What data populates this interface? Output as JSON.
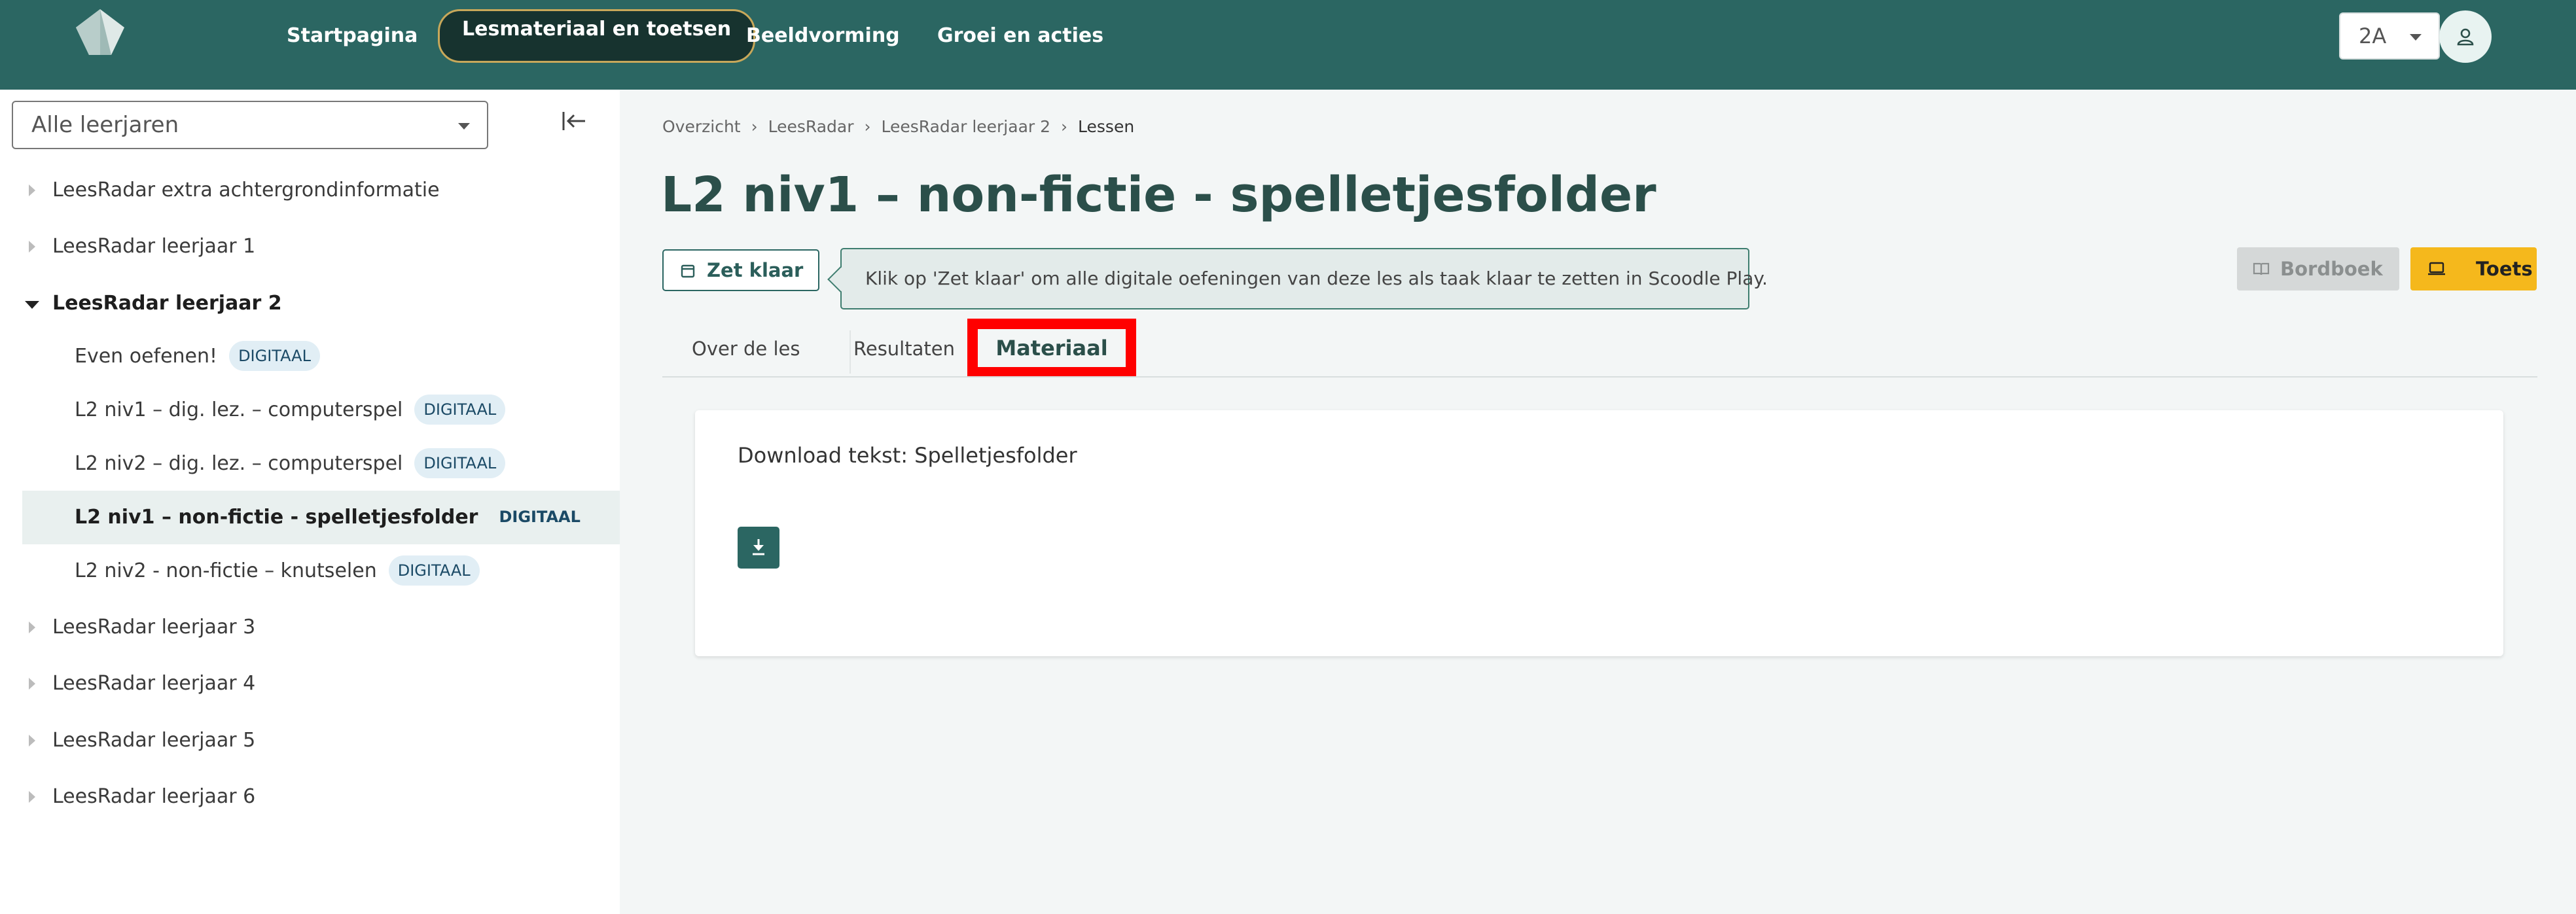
{
  "nav": {
    "items": [
      "Startpagina",
      "Lesmateriaal en toetsen",
      "Beeldvorming",
      "Groei en acties"
    ],
    "active_index": 1,
    "class_select": "2A"
  },
  "sidebar": {
    "year_select": "Alle leerjaren",
    "tree": [
      {
        "label": "LeesRadar extra achtergrondinformatie",
        "expanded": false
      },
      {
        "label": "LeesRadar leerjaar 1",
        "expanded": false
      },
      {
        "label": "LeesRadar leerjaar 2",
        "expanded": true,
        "children": [
          {
            "label": "Even oefenen!",
            "badge": "DIGITAAL"
          },
          {
            "label": "L2 niv1 – dig. lez. – computerspel",
            "badge": "DIGITAAL"
          },
          {
            "label": "L2 niv2 – dig. lez. – computerspel",
            "badge": "DIGITAAL"
          },
          {
            "label": "L2 niv1 – non-fictie - spelletjesfolder",
            "badge": "DIGITAAL",
            "selected": true
          },
          {
            "label": "L2 niv2 - non-fictie – knutselen",
            "badge": "DIGITAAL"
          }
        ]
      },
      {
        "label": "LeesRadar leerjaar 3",
        "expanded": false
      },
      {
        "label": "LeesRadar leerjaar 4",
        "expanded": false
      },
      {
        "label": "LeesRadar leerjaar 5",
        "expanded": false
      },
      {
        "label": "LeesRadar leerjaar 6",
        "expanded": false
      }
    ]
  },
  "main": {
    "breadcrumb": [
      "Overzicht",
      "LeesRadar",
      "LeesRadar leerjaar 2",
      "Lessen"
    ],
    "title": "L2 niv1 – non-fictie - spelletjesfolder",
    "zet_klaar_label": "Zet klaar",
    "tooltip": "Klik op 'Zet klaar' om alle digitale oefeningen van deze les als taak klaar te zetten in Scoodle Play.",
    "bordboek_label": "Bordboek",
    "toets_label": "Toets",
    "tabs": [
      "Over de les",
      "Resultaten",
      "Materiaal"
    ],
    "active_tab": 2,
    "material": {
      "download_text": "Download tekst: Spelletjesfolder"
    }
  },
  "colors": {
    "brand": "#2b6662",
    "accent": "#f5b81c",
    "highlight": "#ff0000"
  }
}
